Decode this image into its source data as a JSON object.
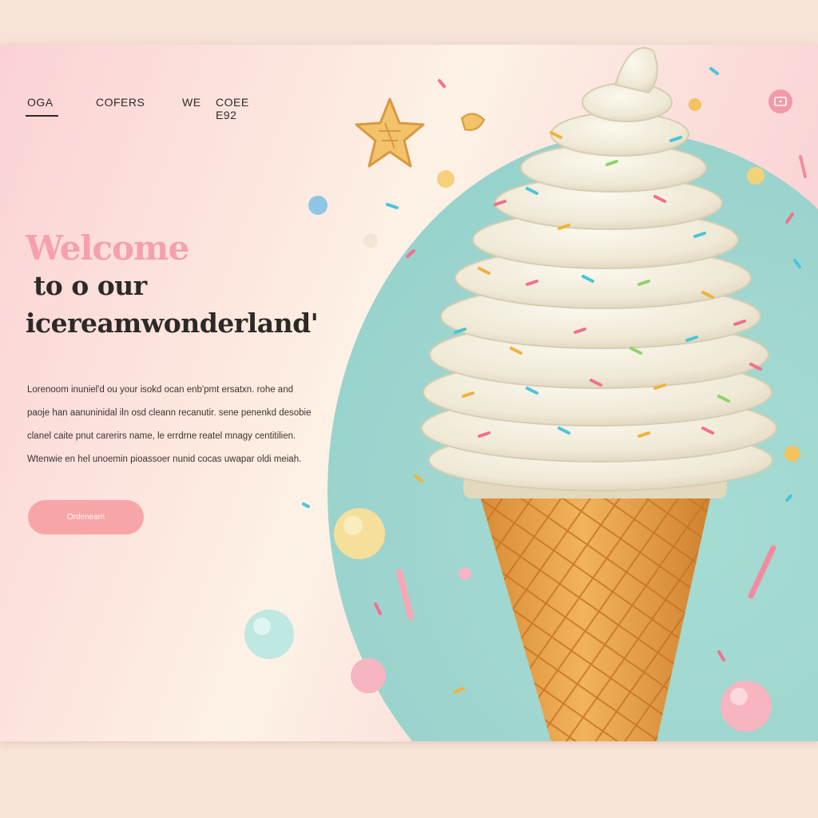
{
  "nav": {
    "items": [
      {
        "label": "OGA",
        "active": true
      },
      {
        "label": "COFERS",
        "active": false
      },
      {
        "label": "WE",
        "active": false
      },
      {
        "label": "COEE E92",
        "active": false
      }
    ],
    "icon": "screen-icon"
  },
  "hero": {
    "title_line1": "Welcome",
    "title_line2": "to o our",
    "title_line3": "icereamwonderland'",
    "body_lines": [
      "Lorenoom inuniel'd ou your isokd ocan enb'pmt ersatxn. rohe and",
      "paoje han aanuninidal iln osd cleann recanutir. sene penenkd desobie",
      "clanel caite pnut carerirs name, le errdrne reatel mnagy centitilien.",
      "Wtenwie en hel unoemin pioassoer nunid cocas uwapar oldi meiah."
    ],
    "cta_label": "Ordeneam"
  },
  "colors": {
    "accent_pink": "#f5a1ac",
    "button_pink": "#f7a6a8",
    "teal": "#9fd6cf",
    "cone": "#e9a24c",
    "cream": "#f4f0e3"
  },
  "decorations": {
    "illustration": "ice-cream-cone",
    "icons": [
      "star-cookie-icon",
      "candy-ball-icon",
      "sprinkle-icon"
    ]
  }
}
